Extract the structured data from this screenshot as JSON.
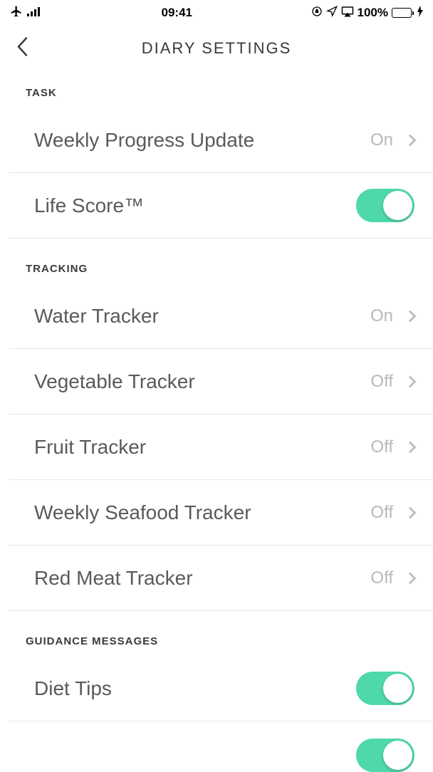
{
  "status_bar": {
    "time": "09:41",
    "battery_pct": "100%"
  },
  "header": {
    "title": "DIARY SETTINGS"
  },
  "sections": {
    "task": {
      "header": "TASK",
      "items": [
        {
          "label": "Weekly Progress Update",
          "value": "On"
        },
        {
          "label": "Life Score™",
          "toggle": true
        }
      ]
    },
    "tracking": {
      "header": "TRACKING",
      "items": [
        {
          "label": "Water Tracker",
          "value": "On"
        },
        {
          "label": "Vegetable Tracker",
          "value": "Off"
        },
        {
          "label": "Fruit Tracker",
          "value": "Off"
        },
        {
          "label": "Weekly Seafood Tracker",
          "value": "Off"
        },
        {
          "label": "Red Meat Tracker",
          "value": "Off"
        }
      ]
    },
    "guidance": {
      "header": "GUIDANCE MESSAGES",
      "items": [
        {
          "label": "Diet Tips",
          "toggle": true
        }
      ]
    }
  }
}
